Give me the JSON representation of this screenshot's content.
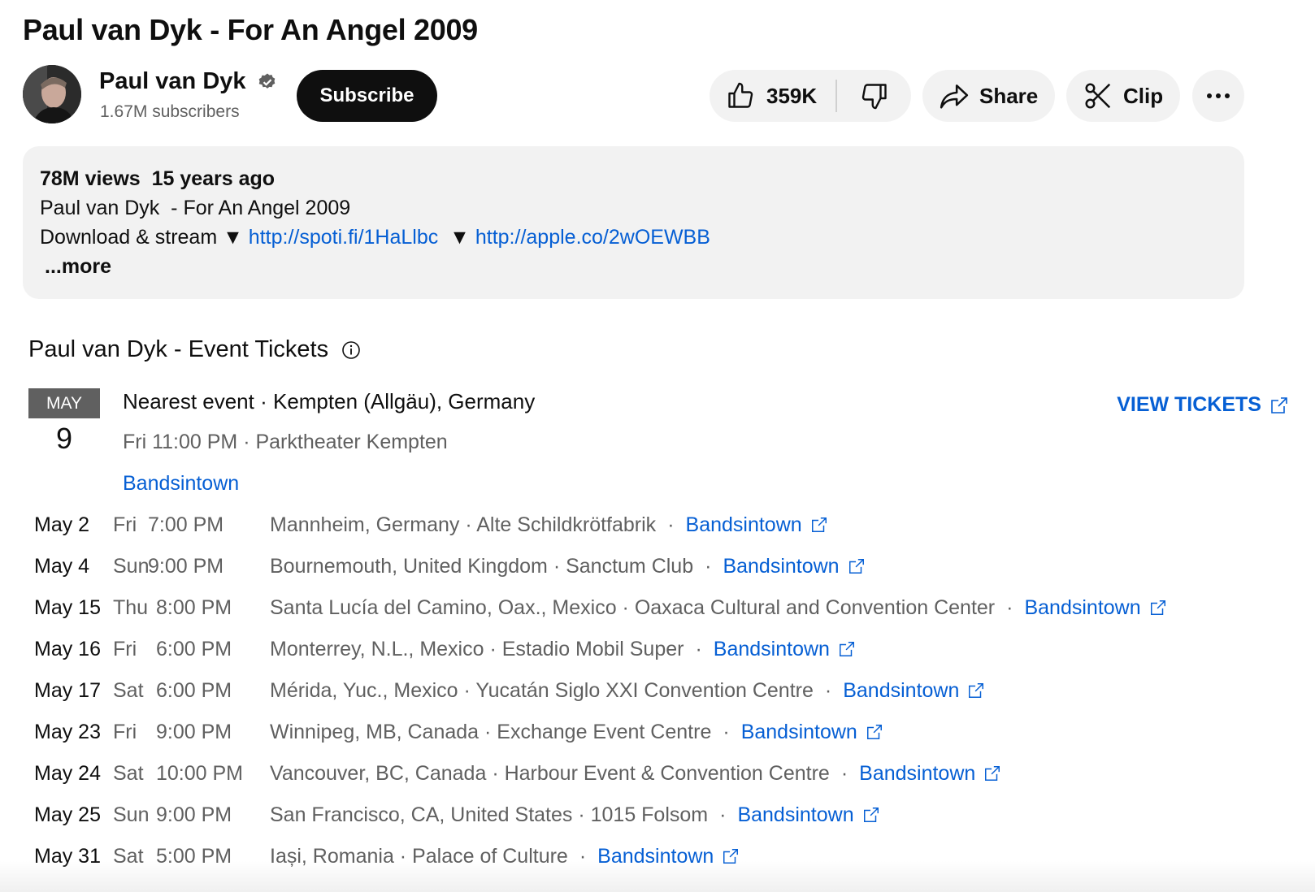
{
  "video": {
    "title": "Paul van Dyk - For An Angel 2009"
  },
  "channel": {
    "name": "Paul van Dyk",
    "subscribers": "1.67M subscribers",
    "subscribe_label": "Subscribe"
  },
  "actions": {
    "likes": "359K",
    "share_label": "Share",
    "clip_label": "Clip"
  },
  "description": {
    "meta": "78M views  15 years ago",
    "line1": "Paul van Dyk  - For An Angel 2009",
    "line2_prefix": "Download & stream ▼ ",
    "spotify_link": "http://spoti.fi/1HaLlbc",
    "line2_mid": "  ▼ ",
    "apple_link": "http://apple.co/2wOEWBB",
    "more_label": "...more"
  },
  "tickets": {
    "heading": "Paul van Dyk - Event Tickets",
    "view_tickets_label": "VIEW TICKETS",
    "nearest": {
      "month": "MAY",
      "day": "9",
      "title": "Nearest event · Kempten (Allgäu), Germany",
      "time": "Fri 11:00 PM · Parktheater Kempten",
      "provider": "Bandsintown"
    },
    "events": [
      {
        "date": "May 2",
        "weekday": "Fri",
        "time": "7:00 PM",
        "location": "Mannheim, Germany · Alte Schildkrötfabrik",
        "provider": "Bandsintown"
      },
      {
        "date": "May 4",
        "weekday": "Sun",
        "time": "9:00 PM",
        "location": "Bournemouth, United Kingdom · Sanctum Club",
        "provider": "Bandsintown"
      },
      {
        "date": "May 15",
        "weekday": "Thu",
        "time": "8:00 PM",
        "location": "Santa Lucía del Camino, Oax., Mexico · Oaxaca Cultural and Convention Center",
        "provider": "Bandsintown"
      },
      {
        "date": "May 16",
        "weekday": "Fri",
        "time": "6:00 PM",
        "location": "Monterrey, N.L., Mexico · Estadio Mobil Super",
        "provider": "Bandsintown"
      },
      {
        "date": "May 17",
        "weekday": "Sat",
        "time": "6:00 PM",
        "location": "Mérida, Yuc., Mexico · Yucatán Siglo XXI Convention Centre",
        "provider": "Bandsintown"
      },
      {
        "date": "May 23",
        "weekday": "Fri",
        "time": "9:00 PM",
        "location": "Winnipeg, MB, Canada · Exchange Event Centre",
        "provider": "Bandsintown"
      },
      {
        "date": "May 24",
        "weekday": "Sat",
        "time": "10:00 PM",
        "location": "Vancouver, BC, Canada · Harbour Event & Convention Centre",
        "provider": "Bandsintown"
      },
      {
        "date": "May 25",
        "weekday": "Sun",
        "time": "9:00 PM",
        "location": "San Francisco, CA, United States · 1015 Folsom",
        "provider": "Bandsintown"
      },
      {
        "date": "May 31",
        "weekday": "Sat",
        "time": "5:00 PM",
        "location": "Iași, Romania · Palace of Culture",
        "provider": "Bandsintown"
      }
    ]
  },
  "icons": {
    "verified": "verified-check-icon",
    "like": "thumbs-up-icon",
    "dislike": "thumbs-down-icon",
    "share": "share-arrow-icon",
    "clip": "scissors-icon",
    "more": "more-horizontal-icon",
    "info": "info-icon",
    "external": "external-link-icon"
  },
  "colors": {
    "link": "#065fd4",
    "button_dark": "#0f0f0f",
    "pill_bg": "#f2f2f2",
    "secondary_text": "#606060"
  }
}
